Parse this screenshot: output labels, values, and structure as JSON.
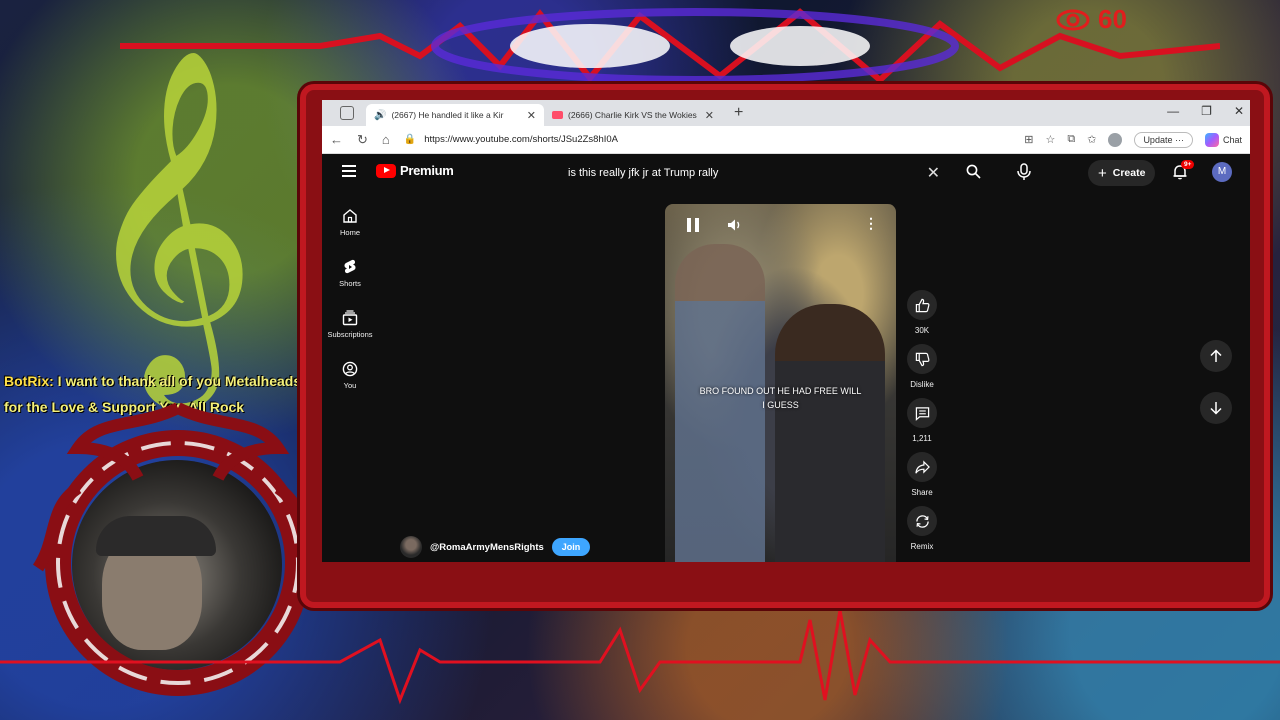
{
  "overlay": {
    "viewer_count": "60",
    "bot_name": "BotRix:",
    "bot_message": " I want to thank all of you Metalheads for the Love & Support You All Rock",
    "icons": [
      "eye-icon",
      "treble-clef-icon"
    ]
  },
  "browser": {
    "tabs": [
      {
        "label": "(2667) He handled it like a Kir",
        "active": true,
        "audio": true
      },
      {
        "label": "(2666) Charlie Kirk VS the Wokies",
        "active": false,
        "audio": false
      }
    ],
    "new_tab": "+",
    "url": "https://www.youtube.com/shorts/JSu2Zs8hI0A",
    "update_label": "Update",
    "update_more": "···",
    "chat_label": "Chat"
  },
  "youtube": {
    "logo_text": "Premium",
    "search_query": "is this really jfk jr at Trump rally",
    "create_label": "Create",
    "notification_badge": "9+",
    "avatar_letter": "M",
    "guide": [
      {
        "label": "Home",
        "icon": "home-icon"
      },
      {
        "label": "Shorts",
        "icon": "shorts-icon"
      },
      {
        "label": "Subscriptions",
        "icon": "subscriptions-icon"
      },
      {
        "label": "You",
        "icon": "you-icon"
      }
    ],
    "video": {
      "caption_line1": "BRO FOUND OUT HE HAD FREE WILL",
      "caption_line2": "I GUESS"
    },
    "channel": {
      "handle": "@RomaArmyMensRights",
      "join_label": "Join"
    },
    "actions": {
      "like": "30K",
      "dislike": "Dislike",
      "comments": "1,211",
      "share": "Share",
      "remix": "Remix"
    }
  },
  "colors": {
    "accent_red": "#ff0000",
    "frame_red": "#c01820",
    "join_blue": "#3ea6ff",
    "yt_bg": "#0f0f0f"
  }
}
